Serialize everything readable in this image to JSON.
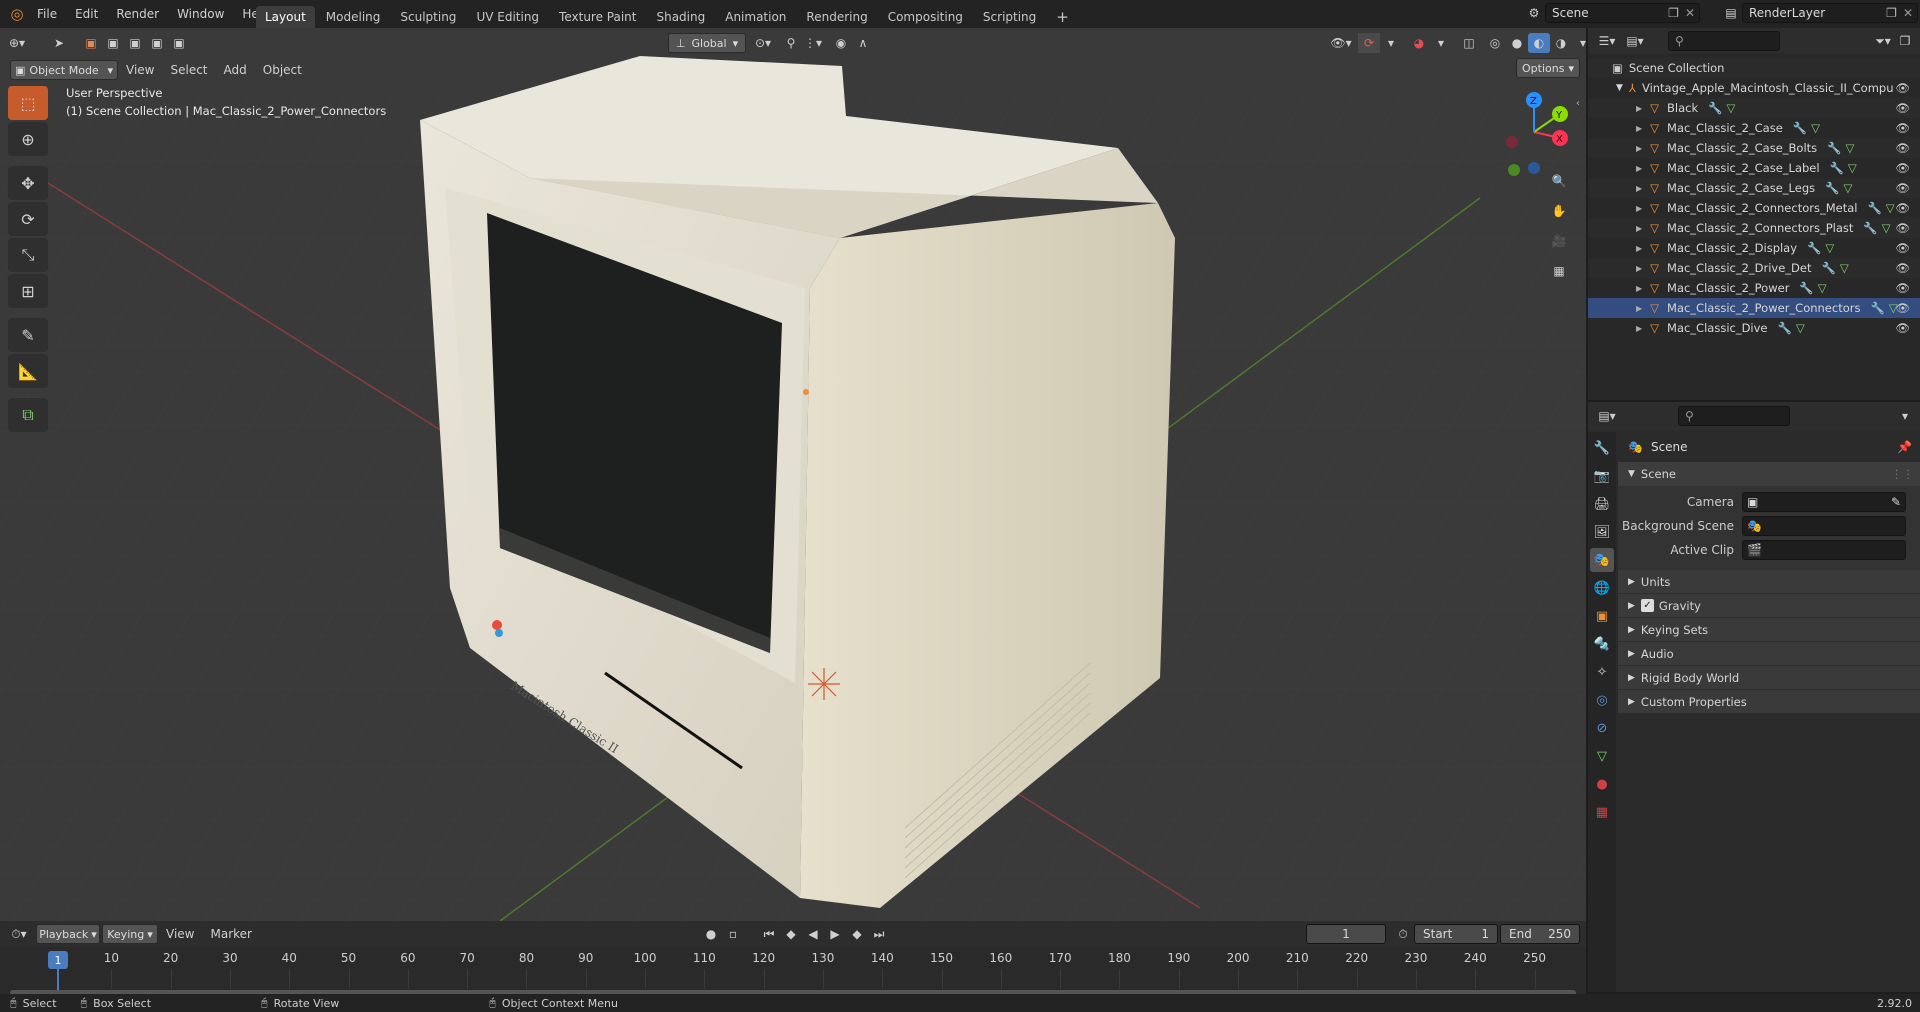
{
  "topbar": {
    "menus": [
      "File",
      "Edit",
      "Render",
      "Window",
      "Help"
    ],
    "workspaces": [
      "Layout",
      "Modeling",
      "Sculpting",
      "UV Editing",
      "Texture Paint",
      "Shading",
      "Animation",
      "Rendering",
      "Compositing",
      "Scripting"
    ],
    "active_workspace": "Layout",
    "add_tab": "+",
    "scene_name": "Scene",
    "view_layer": "RenderLayer"
  },
  "viewport": {
    "mode": "Object Mode",
    "menus": [
      "View",
      "Select",
      "Add",
      "Object"
    ],
    "transform_orientation": "Global",
    "options_label": "Options",
    "info_line1": "User Perspective",
    "info_line2": "(1) Scene Collection | Mac_Classic_2_Power_Connectors",
    "gizmo": {
      "x": "X",
      "y": "Y",
      "z": "Z"
    }
  },
  "outliner": {
    "root": "Scene Collection",
    "collection": "Vintage_Apple_Macintosh_Classic_II_Compu",
    "objects": [
      "Black",
      "Mac_Classic_2_Case",
      "Mac_Classic_2_Case_Bolts",
      "Mac_Classic_2_Case_Label",
      "Mac_Classic_2_Case_Legs",
      "Mac_Classic_2_Connectors_Metal",
      "Mac_Classic_2_Connectors_Plast",
      "Mac_Classic_2_Display",
      "Mac_Classic_2_Drive_Det",
      "Mac_Classic_2_Power",
      "Mac_Classic_2_Power_Connectors",
      "Mac_Classic_Dive"
    ],
    "selected_index": 10
  },
  "properties": {
    "breadcrumb": "Scene",
    "panel_title": "Scene",
    "fields": [
      {
        "label": "Camera"
      },
      {
        "label": "Background Scene"
      },
      {
        "label": "Active Clip"
      }
    ],
    "subpanels": [
      "Units",
      "Gravity",
      "Keying Sets",
      "Audio",
      "Rigid Body World",
      "Custom Properties"
    ],
    "gravity_checked": true
  },
  "timeline": {
    "menus": [
      "Playback",
      "Keying",
      "View",
      "Marker"
    ],
    "current_frame": "1",
    "start_label": "Start",
    "start_value": "1",
    "end_label": "End",
    "end_value": "250",
    "ticks": [
      "1",
      "10",
      "20",
      "30",
      "40",
      "50",
      "60",
      "70",
      "80",
      "90",
      "100",
      "110",
      "120",
      "130",
      "140",
      "150",
      "160",
      "170",
      "180",
      "190",
      "200",
      "210",
      "220",
      "230",
      "240",
      "250"
    ],
    "playhead_label": "1"
  },
  "statusbar": {
    "select": "Select",
    "box_select": "Box Select",
    "rotate_view": "Rotate View",
    "context_menu": "Object Context Menu",
    "version": "2.92.0"
  },
  "model": {
    "label": "Macintosh Classic II"
  },
  "colors": {
    "accent": "#4a7cc0",
    "selected_row": "#334d80",
    "active_tool": "#4a7cc0",
    "object_orange": "#e8903a",
    "axis_red": "#ff3352",
    "axis_green": "#8bdc00",
    "axis_blue": "#2890ff"
  }
}
